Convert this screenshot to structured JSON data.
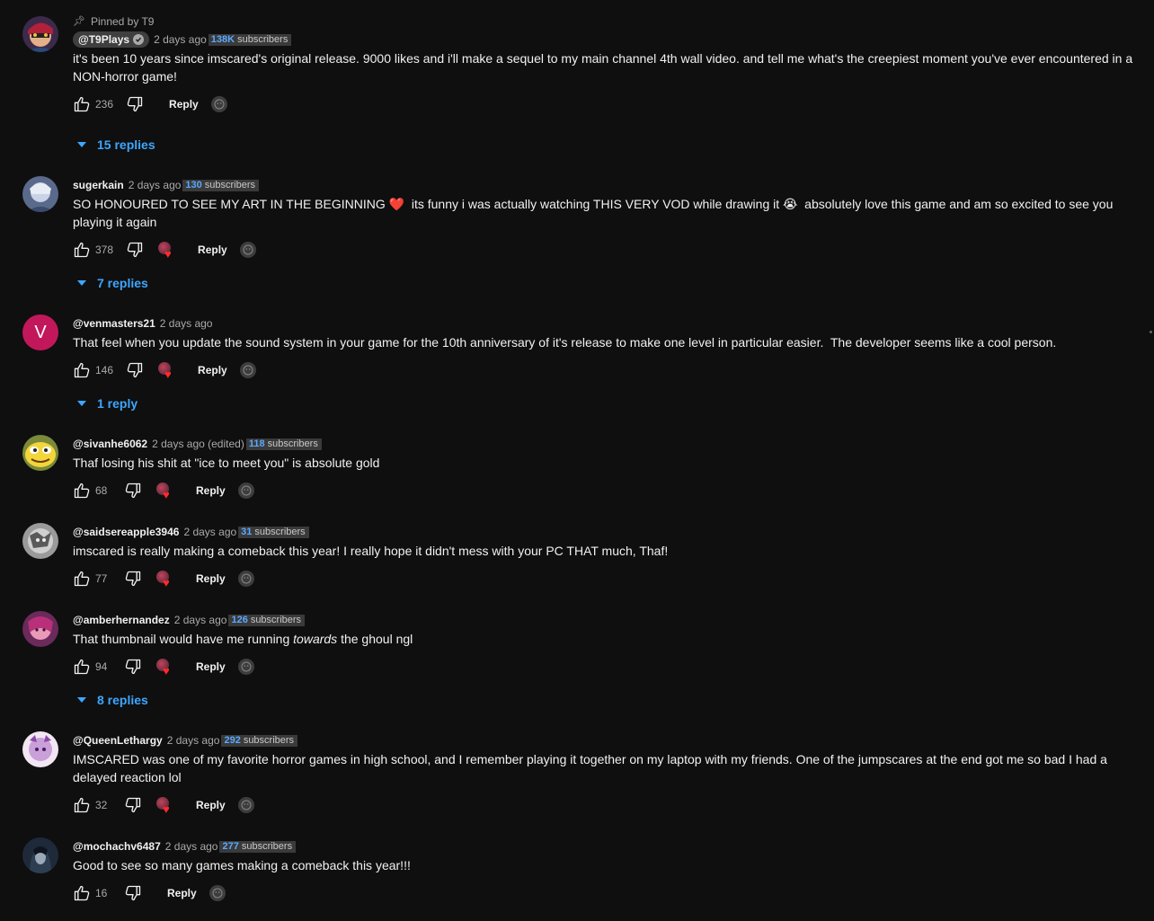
{
  "comments": [
    {
      "pinned_label": "Pinned by T9",
      "author": "@T9Plays",
      "time": "2 days ago",
      "badge_num": "138K",
      "badge_label": "subscribers",
      "text": "it's been 10 years since imscared's original release. 9000 likes and i'll make a sequel to my main channel 4th wall video. and tell me what's the creepiest moment you've ever encountered in a NON-horror game!",
      "likes": "236",
      "reply": "Reply",
      "replies": "15 replies"
    },
    {
      "author": "sugerkain",
      "time": "2 days ago",
      "badge_num": "130",
      "badge_label": "subscribers",
      "text": "SO HONOURED TO SEE MY ART IN THE BEGINNING ❤️  its funny i was actually watching THIS VERY VOD while drawing it 😭  absolutely love this game and am so excited to see you playing it again",
      "likes": "378",
      "reply": "Reply",
      "replies": "7 replies"
    },
    {
      "author": "@venmasters21",
      "time": "2 days ago",
      "avatar_letter": "V",
      "text": "That feel when you update the sound system in your game for the 10th anniversary of it's release to make one level in particular easier.  The developer seems like a cool person.",
      "likes": "146",
      "reply": "Reply",
      "replies": "1 reply"
    },
    {
      "author": "@sivanhe6062",
      "time": "2 days ago (edited)",
      "badge_num": "118",
      "badge_label": "subscribers",
      "text": "Thaf losing his shit at \"ice to meet you\" is absolute gold",
      "likes": "68",
      "reply": "Reply"
    },
    {
      "author": "@saidsereapple3946",
      "time": "2 days ago",
      "badge_num": "31",
      "badge_label": "subscribers",
      "text": "imscared is really making a comeback this year! I really hope it didn't mess with your PC THAT much, Thaf!",
      "likes": "77",
      "reply": "Reply"
    },
    {
      "author": "@amberhernandez",
      "time": "2 days ago",
      "badge_num": "126",
      "badge_label": "subscribers",
      "text_before": "That thumbnail would have me running ",
      "text_em": "towards",
      "text_after": " the ghoul ngl",
      "likes": "94",
      "reply": "Reply",
      "replies": "8 replies"
    },
    {
      "author": "@QueenLethargy",
      "time": "2 days ago",
      "badge_num": "292",
      "badge_label": "subscribers",
      "text": "IMSCARED was one of my favorite horror games in high school, and I remember playing it together on my laptop with my friends. One of the jumpscares at the end got me so bad I had a delayed reaction lol",
      "likes": "32",
      "reply": "Reply"
    },
    {
      "author": "@mochachv6487",
      "time": "2 days ago",
      "badge_num": "277",
      "badge_label": "subscribers",
      "text": "Good to see so many games making a comeback this year!!!",
      "likes": "16",
      "reply": "Reply"
    }
  ],
  "colors": {
    "background": "#0f0f0f",
    "link_blue": "#3ea6ff",
    "badge_blue": "#5aa9ff",
    "heart_red": "#ff2a2a",
    "venmasters_avatar": "#c2185b"
  }
}
